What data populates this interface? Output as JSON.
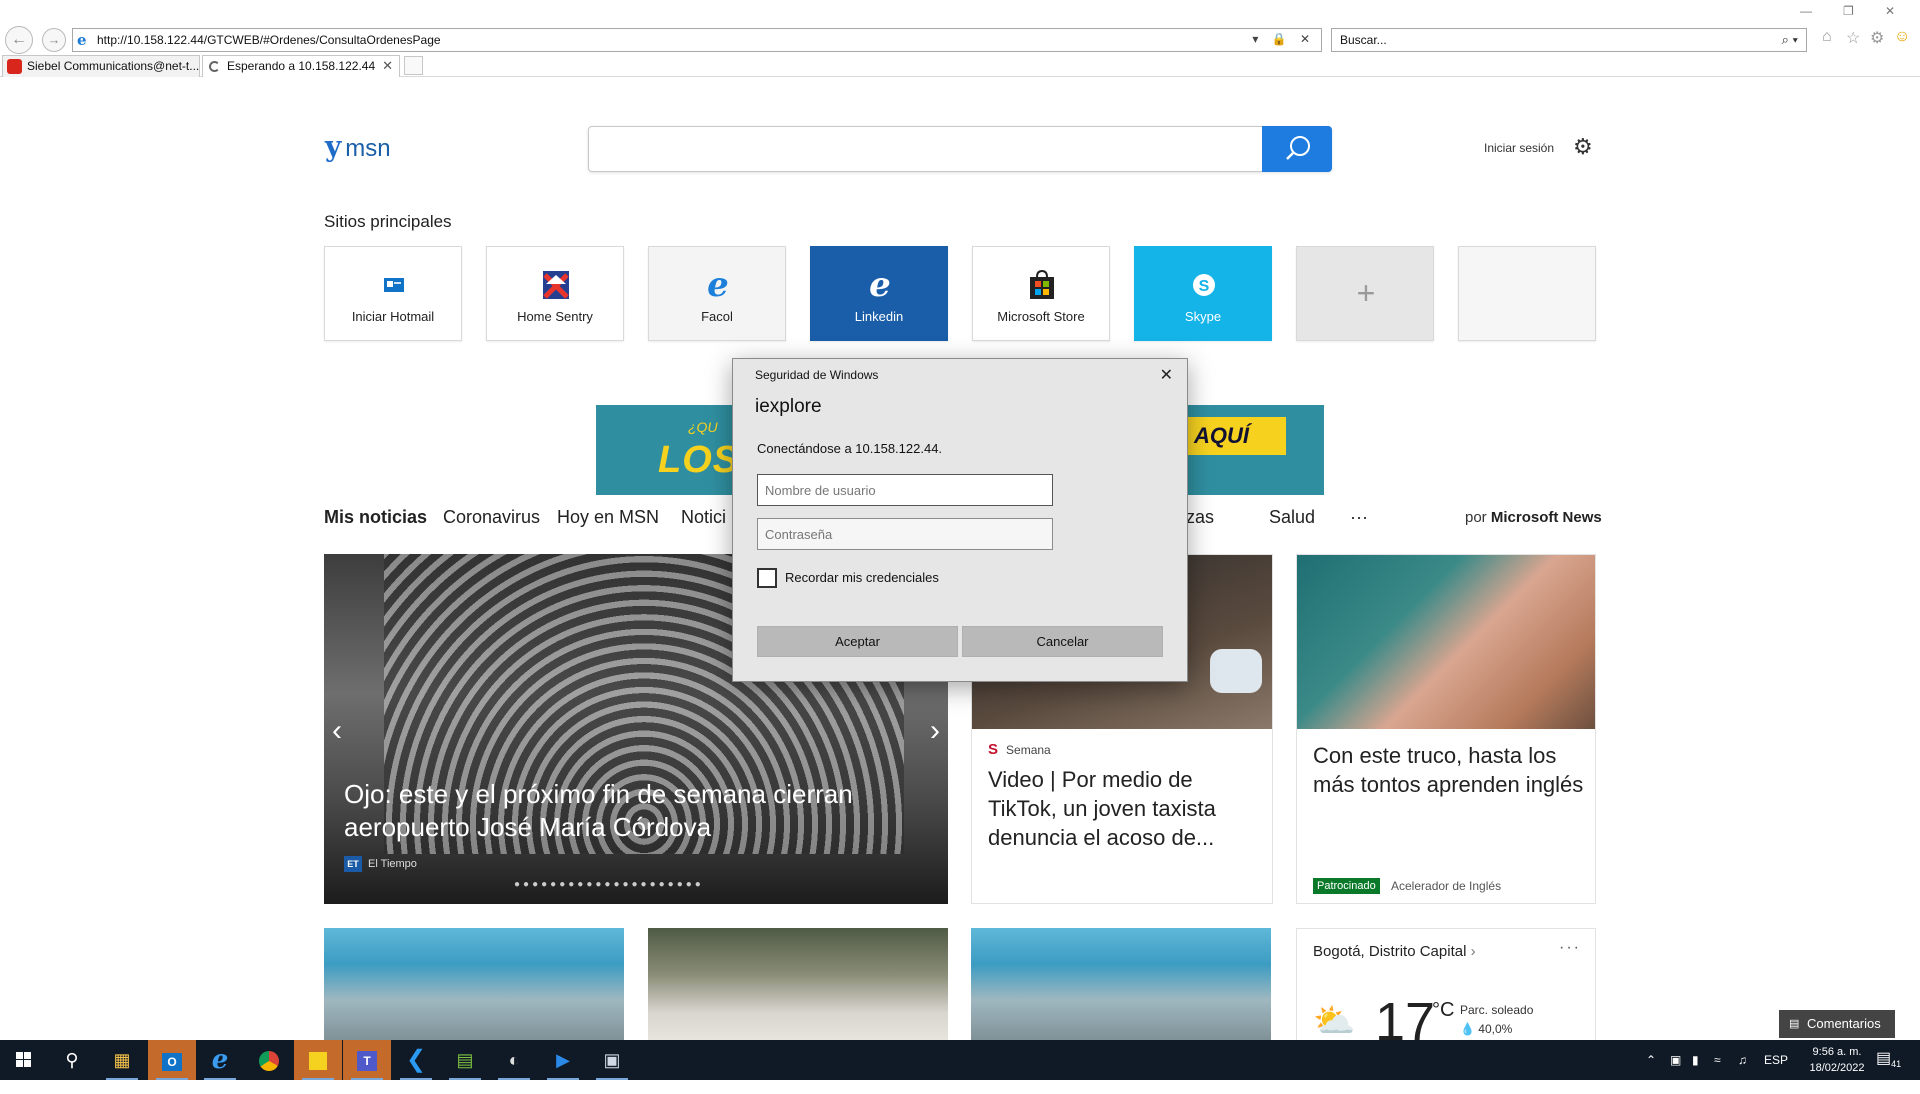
{
  "browser": {
    "url": "http://10.158.122.44/GTCWEB/#Ordenes/ConsultaOrdenesPage",
    "search_placeholder": "Buscar...",
    "tabs": [
      {
        "label": "Siebel Communications@net-t...",
        "active": false
      },
      {
        "label": "Esperando a 10.158.122.44",
        "active": true
      }
    ],
    "address_controls": "▾ 🔒 ✕",
    "search_controls": "⌕ ▾"
  },
  "msn": {
    "logo_text": "msn",
    "signin_label": "Iniciar sesión",
    "top_sites_title": "Sitios principales",
    "tiles": [
      {
        "label": "Iniciar Hotmail",
        "icon": "outlook-icon",
        "bg": "#ffffff"
      },
      {
        "label": "Home Sentry",
        "icon": "home-sentry-icon",
        "bg": "#ffffff"
      },
      {
        "label": "Facol",
        "icon": "ie-icon",
        "bg": "#f4f4f4"
      },
      {
        "label": "Linkedin",
        "icon": "ie-icon",
        "bg": "#1a5da8"
      },
      {
        "label": "Microsoft Store",
        "icon": "store-icon",
        "bg": "#ffffff"
      },
      {
        "label": "Skype",
        "icon": "skype-icon",
        "bg": "#14b4e8"
      },
      {
        "label": "",
        "icon": "plus-icon",
        "bg": "#e6e6e6"
      },
      {
        "label": "",
        "icon": "",
        "bg": "#f6f6f6"
      }
    ],
    "banner_left": "LOS S",
    "banner_left_small": "¿QU",
    "banner_right": "AQUÍ",
    "news_nav": [
      "Mis noticias",
      "Coronavirus",
      "Hoy en MSN",
      "Notici",
      "zas",
      "Salud",
      "···"
    ],
    "by_label": "por",
    "by_brand": "Microsoft News",
    "hero": {
      "title": "Ojo: este y el próximo fin de semana cierran aeropuerto José María Córdova",
      "source": "El Tiempo",
      "source_badge": "ET"
    },
    "card2": {
      "source": "Semana",
      "source_badge": "S",
      "title": "Video | Por medio de TikTok, un joven taxista denuncia el acoso de..."
    },
    "card3": {
      "title": "Con este truco, hasta los más tontos aprenden inglés",
      "badge": "Patrocinado",
      "advertiser": "Acelerador de Inglés"
    },
    "weather": {
      "city": "Bogotá, Distrito Capital",
      "chevron": "›",
      "more": "···",
      "temp": "17",
      "unit": "°C",
      "condition": "Parc. soleado",
      "humidity": "40,0%",
      "humidity_icon": "💧"
    },
    "feedback_label": "Comentarios"
  },
  "dialog": {
    "caption": "Seguridad de Windows",
    "app": "iexplore",
    "message": "Conectándose a 10.158.122.44.",
    "username_placeholder": "Nombre de usuario",
    "password_placeholder": "Contraseña",
    "remember_label": "Recordar mis credenciales",
    "ok_label": "Aceptar",
    "cancel_label": "Cancelar"
  },
  "taskbar": {
    "language": "ESP",
    "time": "9:56 a. m.",
    "date": "18/02/2022",
    "notification_count": "41"
  },
  "colors": {
    "msn_blue": "#1e7ce0",
    "taskbar": "#101a26",
    "dialog_bg": "#e6e6e6"
  }
}
